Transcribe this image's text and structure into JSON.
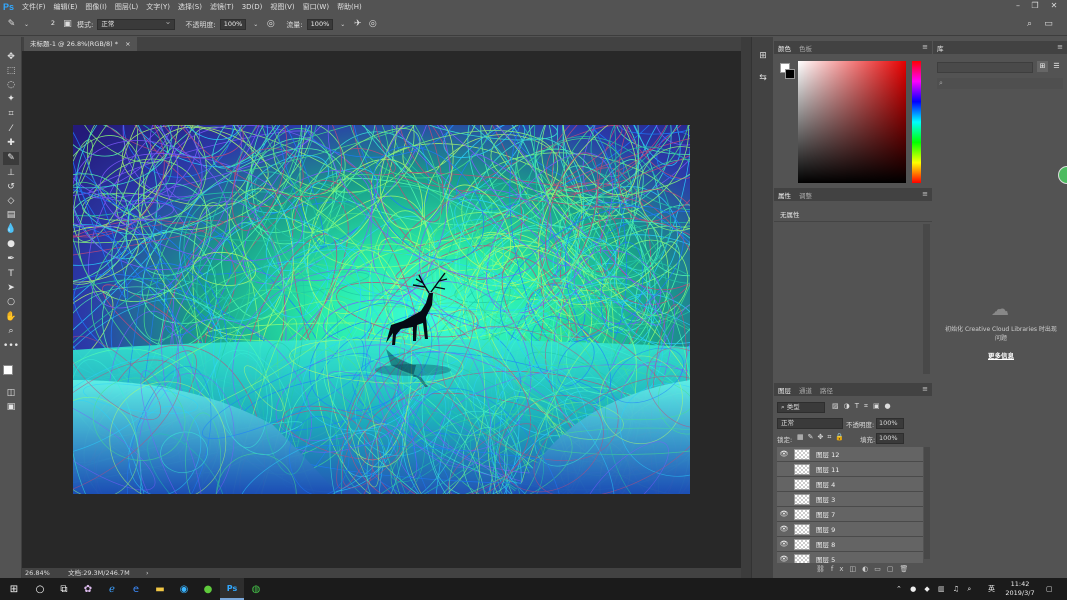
{
  "menubar": {
    "logo": "Ps",
    "items": [
      "文件(F)",
      "编辑(E)",
      "图像(I)",
      "图层(L)",
      "文字(Y)",
      "选择(S)",
      "滤镜(T)",
      "3D(D)",
      "视图(V)",
      "窗口(W)",
      "帮助(H)"
    ]
  },
  "options": {
    "brush_size": "2",
    "mode_label": "模式:",
    "mode_value": "正常",
    "opacity_label": "不透明度:",
    "opacity_value": "100%",
    "flow_label": "流量:",
    "flow_value": "100%"
  },
  "document": {
    "tab_title": "未标题-1 @ 26.8%(RGB/8) *",
    "close": "×"
  },
  "status": {
    "zoom": "26.84%",
    "doc_info": "文档:29.3M/246.7M",
    "arrow": "›"
  },
  "color_panel": {
    "tabs": [
      "颜色",
      "色板"
    ]
  },
  "properties_panel": {
    "tabs": [
      "属性",
      "调整"
    ],
    "content": "无属性"
  },
  "library_panel": {
    "tab": "库",
    "message": "初始化 Creative Cloud Libraries 时出现问题",
    "link": "更多信息"
  },
  "layers_panel": {
    "tabs": [
      "图层",
      "通道",
      "路径"
    ],
    "filter_label": "类型",
    "blend_mode": "正常",
    "opacity_label": "不透明度:",
    "opacity_value": "100%",
    "lock_label": "锁定:",
    "fill_label": "填充:",
    "fill_value": "100%",
    "layers": [
      {
        "name": "图层 12",
        "visible": true
      },
      {
        "name": "图层 11",
        "visible": false
      },
      {
        "name": "图层 4",
        "visible": false
      },
      {
        "name": "图层 3",
        "visible": false
      },
      {
        "name": "图层 7",
        "visible": true
      },
      {
        "name": "图层 9",
        "visible": true
      },
      {
        "name": "图层 8",
        "visible": true
      },
      {
        "name": "图层 5",
        "visible": true
      }
    ]
  },
  "taskbar": {
    "time": "11:42",
    "date": "2019/3/7",
    "ime": "英"
  },
  "colors": {
    "app_bg": "#535353",
    "canvas_bg": "#282828",
    "ps_blue": "#31a8ff",
    "taskbar": "#1b1b1b"
  }
}
